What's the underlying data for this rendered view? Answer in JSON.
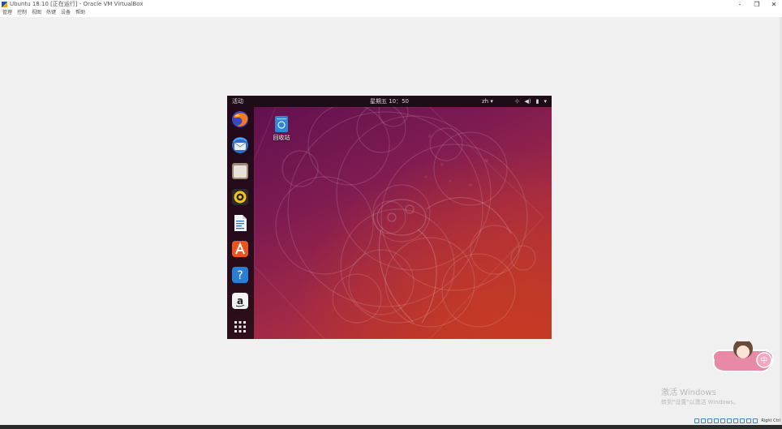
{
  "host": {
    "window_title": "Ubuntu 18.10 [正在运行] - Oracle VM VirtualBox",
    "window_buttons": [
      "-",
      "❐",
      "✕"
    ],
    "menu": [
      "管理",
      "控制",
      "视图",
      "热键",
      "设备",
      "帮助"
    ],
    "status_hostkey": "Right Ctrl"
  },
  "ubuntu": {
    "activities": "活动",
    "clock": "星期五 10：50",
    "lang": "zh ▾",
    "tray_icons": [
      "network-icon",
      "volume-icon",
      "battery-icon",
      "arrow-down-icon"
    ],
    "desktop_icon_label": "回收站",
    "dock": [
      "firefox",
      "thunderbird",
      "files",
      "rhythmbox",
      "libreoffice-writer",
      "software",
      "help",
      "amazon",
      "show-apps"
    ]
  },
  "watermark": {
    "line1": "激活 Windows",
    "line2": "转到\"设置\"以激活 Windows。"
  },
  "sticker": {
    "char": "中"
  },
  "colors": {
    "topbar": "#1e0c17",
    "accent": "#e95420"
  }
}
